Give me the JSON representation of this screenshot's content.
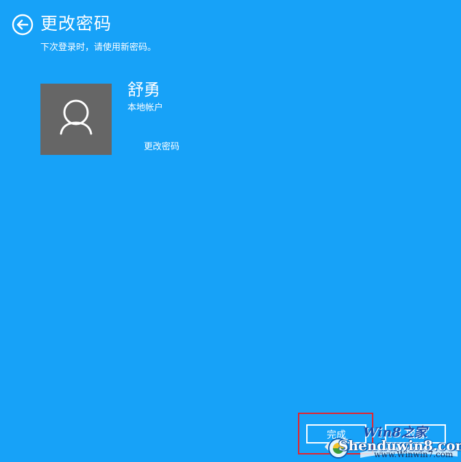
{
  "header": {
    "back_icon": "arrow-left-circle-icon",
    "title": "更改密码",
    "subtitle": "下次登录时，请使用新密码。"
  },
  "account": {
    "avatar_icon": "user-silhouette-icon",
    "name": "舒勇",
    "type": "本地帐户",
    "action": "更改密码"
  },
  "footer": {
    "finish_label": "完成",
    "cancel_label": "取消",
    "highlight_color": "#e8222a"
  },
  "watermark": {
    "title": "Win8之家",
    "brand": "Shenduwin8.com",
    "url": "www.Winwin7.com"
  },
  "colors": {
    "background": "#17a2f8",
    "avatar_background": "#666666",
    "foreground": "#ffffff"
  }
}
